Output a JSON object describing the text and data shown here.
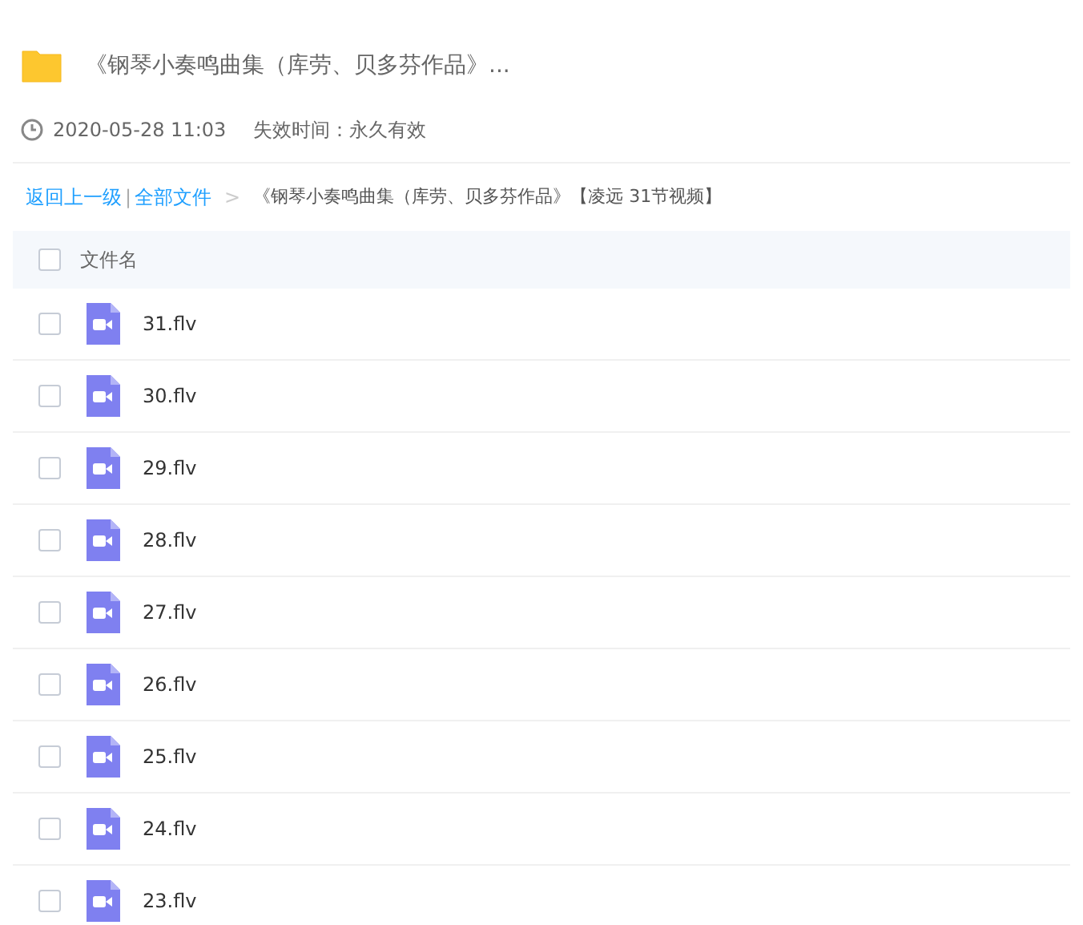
{
  "title": "《钢琴小奏鸣曲集（库劳、贝多芬作品》...",
  "meta": {
    "date": "2020-05-28 11:03",
    "expiry": "失效时间：永久有效"
  },
  "breadcrumb": {
    "back": "返回上一级",
    "separator": "|",
    "root": "全部文件",
    "arrow": ">",
    "current": "《钢琴小奏鸣曲集（库劳、贝多芬作品》【凌远 31节视频】"
  },
  "table": {
    "header": {
      "label": "文件名",
      "checked": false
    },
    "rows": [
      {
        "name": "31.flv",
        "checked": false
      },
      {
        "name": "30.flv",
        "checked": false
      },
      {
        "name": "29.flv",
        "checked": false
      },
      {
        "name": "28.flv",
        "checked": false
      },
      {
        "name": "27.flv",
        "checked": false
      },
      {
        "name": "26.flv",
        "checked": false
      },
      {
        "name": "25.flv",
        "checked": false
      },
      {
        "name": "24.flv",
        "checked": false
      },
      {
        "name": "23.flv",
        "checked": false
      }
    ]
  }
}
